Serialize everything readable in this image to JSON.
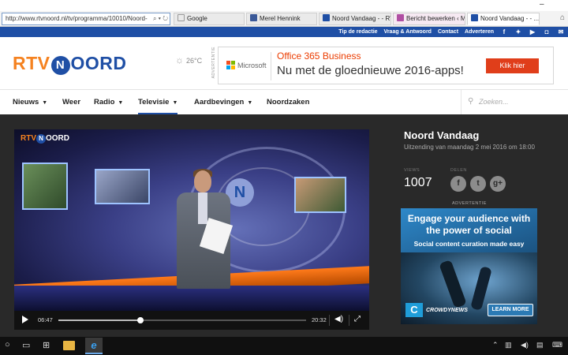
{
  "browser": {
    "address": "http://www.rtvnoord.nl/tv/programma/10010/Noord-",
    "tabs": [
      {
        "label": "Google",
        "favicon_color": "#ffffff"
      },
      {
        "label": "Merel Hennink",
        "favicon_color": "#3b5998"
      },
      {
        "label": "Noord Vandaag - - RTV...",
        "favicon_color": "#1f4fa5"
      },
      {
        "label": "Bericht bewerken ‹ Me...",
        "favicon_color": "#b04fa3"
      },
      {
        "label": "Noord Vandaag - - ...",
        "favicon_color": "#1f4fa5"
      }
    ],
    "window_controls": {
      "minimize": "–"
    }
  },
  "utilbar": {
    "links": [
      "Tip de redactie",
      "Vraag & Antwoord",
      "Contact",
      "Adverteren"
    ],
    "social": [
      "facebook-icon",
      "twitter-icon",
      "youtube-icon",
      "instagram-icon",
      "mail-icon"
    ]
  },
  "header": {
    "logo": {
      "part1": "RTV",
      "badge": "N",
      "part2": "OORD"
    },
    "weather": "26°C",
    "ad": {
      "label": "ADVERTENTIE",
      "brand": "Microsoft",
      "title": "Office 365 Business",
      "subtitle": "Nu met de gloednieuwe 2016-apps!",
      "cta": "Klik hier"
    }
  },
  "nav": {
    "items": [
      {
        "label": "Nieuws",
        "dropdown": true
      },
      {
        "label": "Weer",
        "dropdown": false
      },
      {
        "label": "Radio",
        "dropdown": true
      },
      {
        "label": "Televisie",
        "dropdown": true,
        "active": true
      },
      {
        "label": "Aardbevingen",
        "dropdown": true
      },
      {
        "label": "Noordzaken",
        "dropdown": false
      }
    ],
    "search_placeholder": "Zoeken..."
  },
  "player": {
    "overlay_logo": {
      "part1": "RTV",
      "badge": "N",
      "part2": "OORD"
    },
    "current_time": "06:47",
    "duration": "20:32",
    "progress": 0.33
  },
  "show": {
    "title": "Noord Vandaag",
    "subtitle": "Uitzending van maandag 2 mei 2016 om 18:00",
    "views_label": "VIEWS",
    "views": "1007",
    "share_label": "DELEN",
    "share_buttons": [
      "f",
      "t",
      "g+"
    ]
  },
  "side_ad": {
    "label": "ADVERTENTIE",
    "headline": "Engage your audience with the power of social",
    "subline": "Social content curation made easy",
    "brand": "CROWDYNEWS",
    "cta": "LEARN MORE"
  }
}
